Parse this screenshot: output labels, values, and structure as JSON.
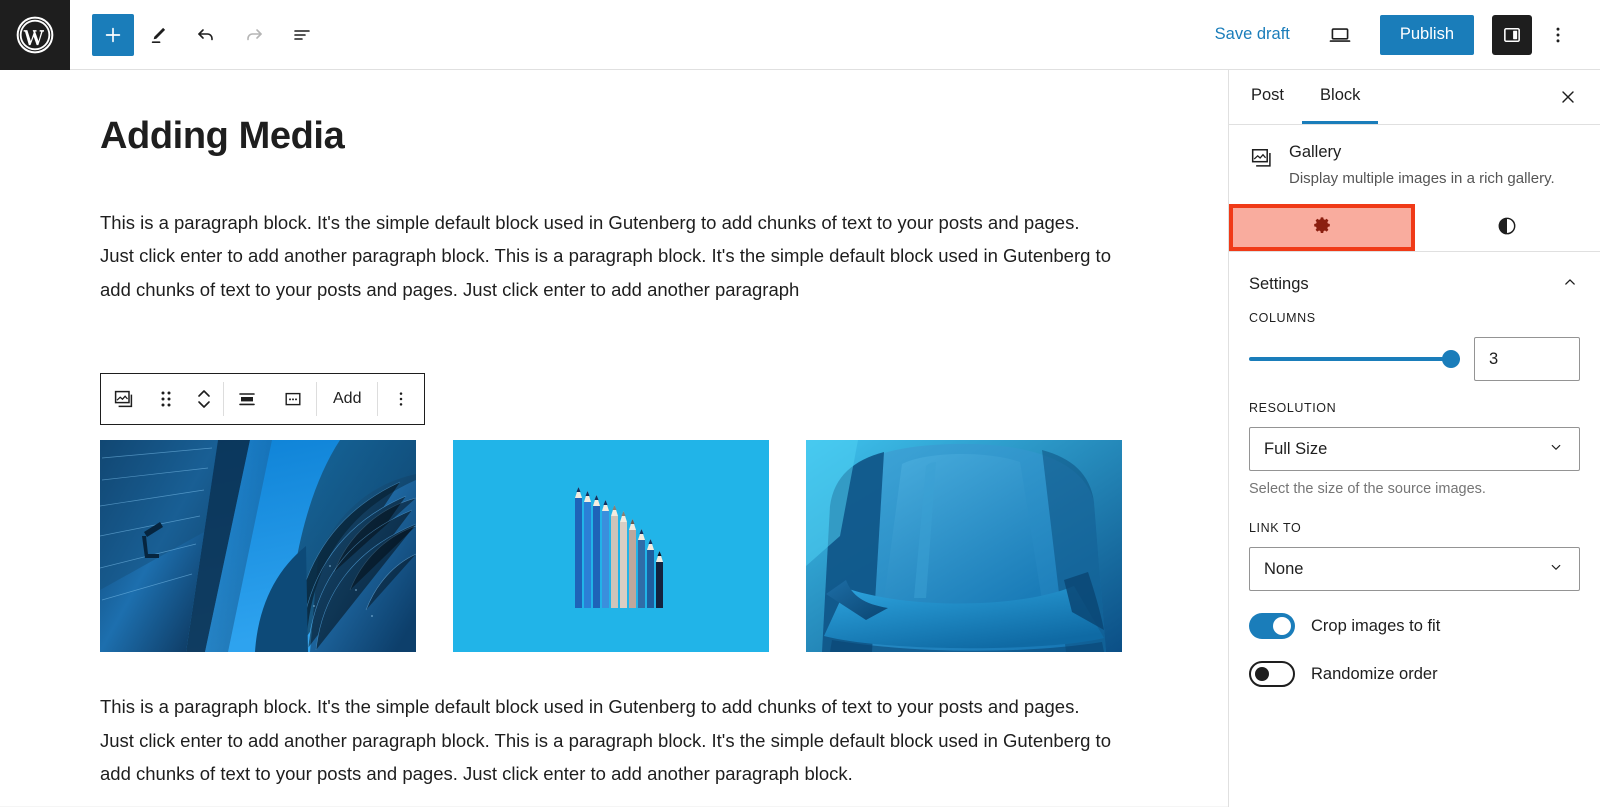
{
  "topbar": {
    "logo_icon": "wordpress-logo-icon",
    "add_block_icon": "plus-icon",
    "add_block_label": "+",
    "edit_icon": "pencil-icon",
    "undo_icon": "undo-arrow-icon",
    "redo_icon": "redo-arrow-icon",
    "list_view_icon": "list-view-icon",
    "save_draft_label": "Save draft",
    "preview_icon": "laptop-preview-icon",
    "publish_label": "Publish",
    "sidebar_toggle_icon": "sidebar-panel-icon",
    "more_icon": "vertical-ellipsis-icon",
    "accent_blue": "#1a7dba",
    "dark": "#1e1e1e"
  },
  "editor": {
    "title": "Adding Media",
    "paragraph_1": "This is a paragraph block. It's the simple default block used in Gutenberg to add chunks of text to your posts and pages. Just click enter to add another paragraph block. This is a paragraph block. It's the simple default block used in Gutenberg to add chunks of text to your posts and pages. Just click enter to add another paragraph",
    "paragraph_2": "This is a paragraph block. It's the simple default block used in Gutenberg to add chunks of text to your posts and pages. Just click enter to add another paragraph block. This is a paragraph block. It's the simple default block used in Gutenberg to add chunks of text to your posts and pages. Just click enter to add another paragraph block."
  },
  "block_toolbar": {
    "block_type_icon": "gallery-icon",
    "drag_handle_icon": "drag-dots-icon",
    "move_icon": "move-up-down-chevrons-icon",
    "align_icon": "align-center-icon",
    "crop_icon": "more-box-icon",
    "add_label": "Add",
    "options_icon": "vertical-ellipsis-icon"
  },
  "gallery": {
    "images": [
      {
        "name": "skyscrapers-photo",
        "alt": "Glass skyscrapers seen from below against a blue sky"
      },
      {
        "name": "pencils-photo",
        "alt": "Blue and grey pencils arranged by height on a cyan background"
      },
      {
        "name": "armchair-photo",
        "alt": "A blue upholstered armchair"
      }
    ]
  },
  "sidebar": {
    "tabs": [
      {
        "label": "Post",
        "active": false
      },
      {
        "label": "Block",
        "active": true
      }
    ],
    "close_icon": "close-x-icon",
    "block": {
      "icon": "gallery-icon",
      "title": "Gallery",
      "description": "Display multiple images in a rich gallery."
    },
    "icon_tabs": [
      {
        "name": "settings-tab",
        "icon": "gear-icon",
        "highlighted": true
      },
      {
        "name": "styles-tab",
        "icon": "contrast-half-circle-icon",
        "highlighted": false
      }
    ],
    "highlight_border_color": "#f03a17",
    "highlight_fill_color": "#fba08c",
    "settings": {
      "section_label": "Settings",
      "collapse_icon": "chevron-up-icon",
      "columns_label": "COLUMNS",
      "columns_value": "3",
      "columns_slider_percent": 100,
      "resolution_label": "RESOLUTION",
      "resolution_value": "Full Size",
      "resolution_help": "Select the size of the source images.",
      "link_to_label": "LINK TO",
      "link_to_value": "None",
      "dropdown_icon": "chevron-down-icon",
      "toggles": [
        {
          "label": "Crop images to fit",
          "on": true
        },
        {
          "label": "Randomize order",
          "on": false
        }
      ]
    }
  }
}
